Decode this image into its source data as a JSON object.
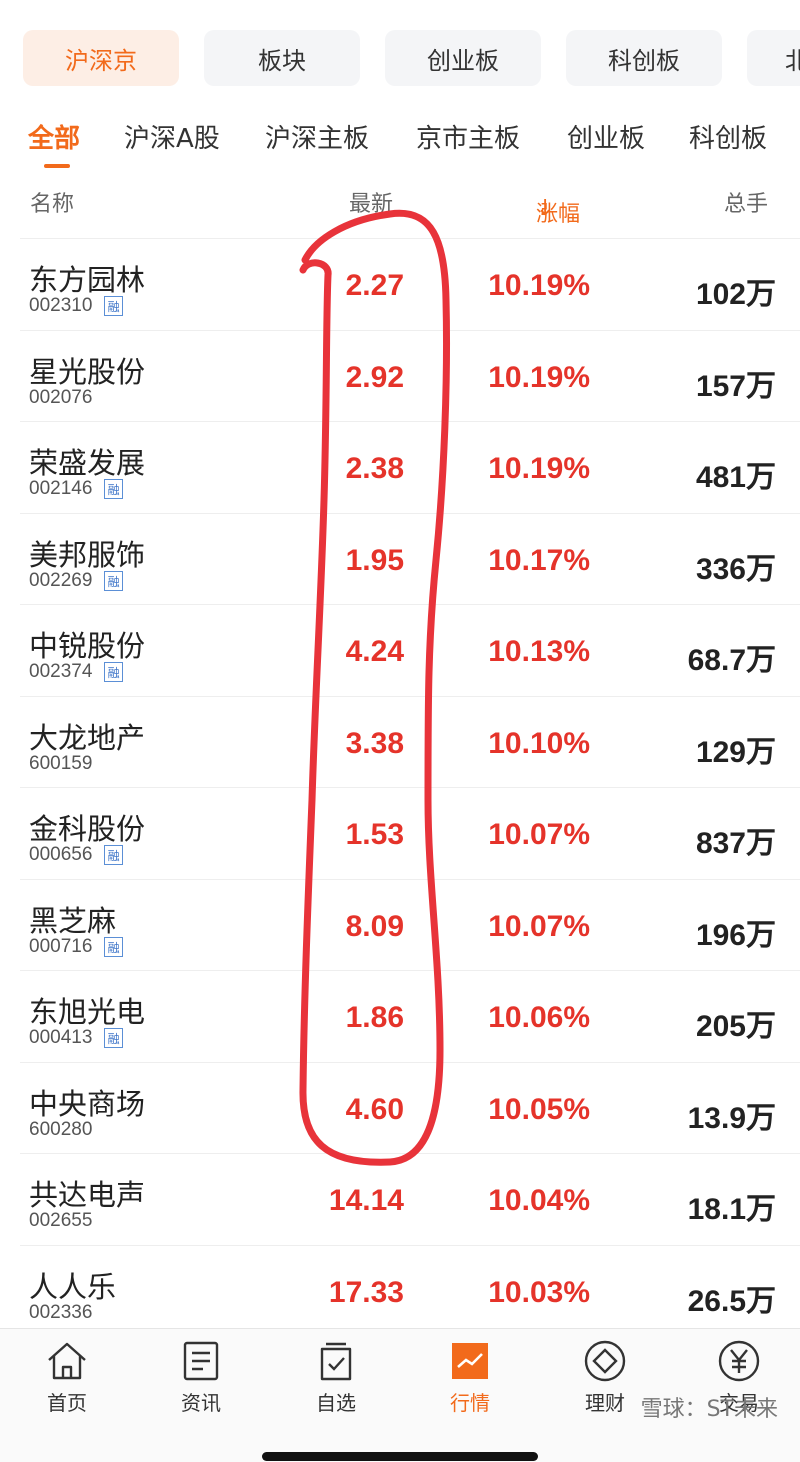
{
  "market_tabs": [
    {
      "label": "沪深京",
      "active": true
    },
    {
      "label": "板块",
      "active": false
    },
    {
      "label": "创业板",
      "active": false
    },
    {
      "label": "科创板",
      "active": false
    },
    {
      "label": "北",
      "active": false
    }
  ],
  "sub_tabs": [
    {
      "label": "全部",
      "active": true
    },
    {
      "label": "沪深A股",
      "active": false
    },
    {
      "label": "沪深主板",
      "active": false
    },
    {
      "label": "京市主板",
      "active": false
    },
    {
      "label": "创业板",
      "active": false
    },
    {
      "label": "科创板",
      "active": false
    }
  ],
  "columns": {
    "name": "名称",
    "latest": "最新",
    "change": "涨幅",
    "sort_indicator": "↓",
    "volume": "总手"
  },
  "stocks": [
    {
      "name": "东方园林",
      "code": "002310",
      "margin": true,
      "price": "2.27",
      "change": "10.19%",
      "volume": "102万"
    },
    {
      "name": "星光股份",
      "code": "002076",
      "margin": false,
      "price": "2.92",
      "change": "10.19%",
      "volume": "157万"
    },
    {
      "name": "荣盛发展",
      "code": "002146",
      "margin": true,
      "price": "2.38",
      "change": "10.19%",
      "volume": "481万"
    },
    {
      "name": "美邦服饰",
      "code": "002269",
      "margin": true,
      "price": "1.95",
      "change": "10.17%",
      "volume": "336万"
    },
    {
      "name": "中锐股份",
      "code": "002374",
      "margin": true,
      "price": "4.24",
      "change": "10.13%",
      "volume": "68.7万"
    },
    {
      "name": "大龙地产",
      "code": "600159",
      "margin": false,
      "price": "3.38",
      "change": "10.10%",
      "volume": "129万"
    },
    {
      "name": "金科股份",
      "code": "000656",
      "margin": true,
      "price": "1.53",
      "change": "10.07%",
      "volume": "837万"
    },
    {
      "name": "黑芝麻",
      "code": "000716",
      "margin": true,
      "price": "8.09",
      "change": "10.07%",
      "volume": "196万"
    },
    {
      "name": "东旭光电",
      "code": "000413",
      "margin": true,
      "price": "1.86",
      "change": "10.06%",
      "volume": "205万"
    },
    {
      "name": "中央商场",
      "code": "600280",
      "margin": false,
      "price": "4.60",
      "change": "10.05%",
      "volume": "13.9万"
    },
    {
      "name": "共达电声",
      "code": "002655",
      "margin": false,
      "price": "14.14",
      "change": "10.04%",
      "volume": "18.1万"
    },
    {
      "name": "人人乐",
      "code": "002336",
      "margin": false,
      "price": "17.33",
      "change": "10.03%",
      "volume": "26.5万"
    }
  ],
  "margin_badge": "融",
  "bottom_nav": [
    {
      "label": "首页",
      "icon": "home-icon",
      "active": false
    },
    {
      "label": "资讯",
      "icon": "news-icon",
      "active": false
    },
    {
      "label": "自选",
      "icon": "watchlist-icon",
      "active": false
    },
    {
      "label": "行情",
      "icon": "market-chart-icon",
      "active": true
    },
    {
      "label": "理财",
      "icon": "diamond-icon",
      "active": false
    },
    {
      "label": "交易",
      "icon": "yen-icon",
      "active": false
    }
  ],
  "watermark": "雪球：ST未来",
  "colors": {
    "accent": "#f26a1b",
    "up_red": "#e5332a",
    "annotation_red": "#e8333a",
    "margin_blue": "#3d74c8"
  }
}
